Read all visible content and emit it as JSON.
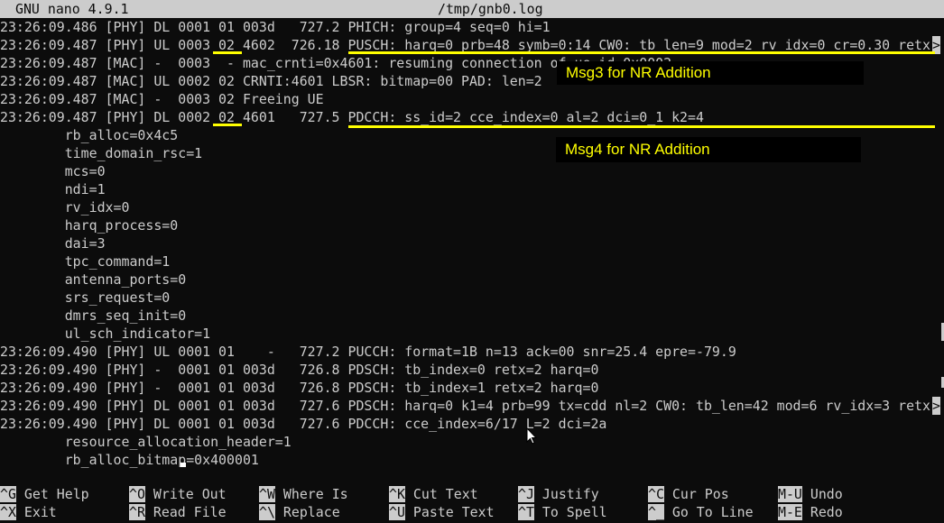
{
  "titlebar": {
    "app": "GNU nano 4.9.1",
    "file": "/tmp/gnb0.log"
  },
  "lines": [
    "23:26:09.486 [PHY] DL 0001 01 003d   727.2 PHICH: group=4 seq=0 hi=1",
    "23:26:09.487 [PHY] UL 0003 02 4602  726.18 PUSCH: harq=0 prb=48 symb=0:14 CW0: tb_len=9 mod=2 rv_idx=0 cr=0.30 retx",
    "23:26:09.487 [MAC] -  0003  - mac_crnti=0x4601: resuming connection of ue_id 0x0002",
    "23:26:09.487 [MAC] UL 0002 02 CRNTI:4601 LBSR: bitmap=00 PAD: len=2",
    "23:26:09.487 [MAC] -  0003 02 Freeing UE",
    "23:26:09.487 [PHY] DL 0002 02 4601   727.5 PDCCH: ss_id=2 cce_index=0 al=2 dci=0_1 k2=4",
    "        rb_alloc=0x4c5",
    "        time_domain_rsc=1",
    "        mcs=0",
    "        ndi=1",
    "        rv_idx=0",
    "        harq_process=0",
    "        dai=3",
    "        tpc_command=1",
    "        antenna_ports=0",
    "        srs_request=0",
    "        dmrs_seq_init=0",
    "        ul_sch_indicator=1",
    "23:26:09.490 [PHY] UL 0001 01    -   727.2 PUCCH: format=1B n=13 ack=00 snr=25.4 epre=-79.9",
    "23:26:09.490 [PHY] -  0001 01 003d   726.8 PDSCH: tb_index=0 retx=2 harq=0",
    "23:26:09.490 [PHY] -  0001 01 003d   726.8 PDSCH: tb_index=1 retx=2 harq=0",
    "23:26:09.490 [PHY] DL 0001 01 003d   727.6 PDSCH: harq=0 k1=4 prb=99 tx=cdd nl=2 CW0: tb_len=42 mod=6 rv_idx=3 retx",
    "23:26:09.490 [PHY] DL 0001 01 003d   727.6 PDCCH: cce_index=6/17 L=2 dci=2a",
    "        resource_allocation_header=1",
    "        rb_alloc_bitmap=0x400001",
    ""
  ],
  "truncation_marker": ">",
  "annotations": {
    "msg3": "Msg3 for NR Addition",
    "msg4": "Msg4 for NR Addition",
    "highlight_color": "#ffff00"
  },
  "help": [
    [
      {
        "key": "^G",
        "label": "Get Help"
      },
      {
        "key": "^O",
        "label": "Write Out"
      },
      {
        "key": "^W",
        "label": "Where Is"
      },
      {
        "key": "^K",
        "label": "Cut Text"
      },
      {
        "key": "^J",
        "label": "Justify"
      },
      {
        "key": "^C",
        "label": "Cur Pos"
      },
      {
        "key": "M-U",
        "label": "Undo"
      }
    ],
    [
      {
        "key": "^X",
        "label": "Exit"
      },
      {
        "key": "^R",
        "label": "Read File"
      },
      {
        "key": "^\\",
        "label": "Replace"
      },
      {
        "key": "^U",
        "label": "Paste Text"
      },
      {
        "key": "^T",
        "label": "To Spell"
      },
      {
        "key": "^_",
        "label": "Go To Line"
      },
      {
        "key": "M-E",
        "label": "Redo"
      }
    ]
  ]
}
